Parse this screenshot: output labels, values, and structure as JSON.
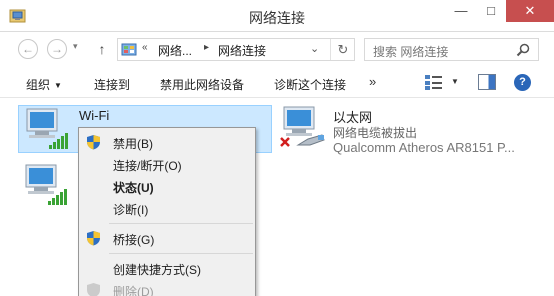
{
  "window": {
    "title": "网络连接",
    "minimize_glyph": "—",
    "maximize_glyph": "□",
    "close_glyph": "✕"
  },
  "address_bar": {
    "back_glyph": "←",
    "forward_glyph": "→",
    "up_glyph": "↑",
    "overflow": "«",
    "crumb_1": "网络...",
    "crumb_sep": "▸",
    "crumb_2": "网络连接",
    "dropdown_glyph": "⌄",
    "refresh_glyph": "↻",
    "search_placeholder": "搜索 网络连接"
  },
  "command_bar": {
    "organize": "组织",
    "connect_to": "连接到",
    "disable_device": "禁用此网络设备",
    "diagnose": "诊断这个连接",
    "more": "»",
    "help": "?"
  },
  "adapters": [
    {
      "name": "Wi-Fi",
      "status": "",
      "icon": "wireless-network-icon"
    },
    {
      "name": "以太网",
      "status": "网络电缆被拔出",
      "device": "Qualcomm Atheros AR8151 P...",
      "icon": "ethernet-disconnected-icon"
    },
    {
      "name": "",
      "status": "",
      "icon": "wireless-network-icon"
    }
  ],
  "context_menu": {
    "items": [
      {
        "label": "禁用(B)",
        "shield": true,
        "bold": false,
        "disabled": false
      },
      {
        "label": "连接/断开(O)",
        "shield": false,
        "bold": false,
        "disabled": false
      },
      {
        "label": "状态(U)",
        "shield": false,
        "bold": true,
        "disabled": false
      },
      {
        "label": "诊断(I)",
        "shield": false,
        "bold": false,
        "disabled": false
      },
      {
        "label": "桥接(G)",
        "shield": true,
        "bold": false,
        "disabled": false
      },
      {
        "label": "创建快捷方式(S)",
        "shield": false,
        "bold": false,
        "disabled": false
      },
      {
        "label": "删除(D)",
        "shield": true,
        "bold": false,
        "disabled": true
      }
    ]
  },
  "colors": {
    "selection_bg": "#cce8ff",
    "selection_border": "#99d1ff",
    "close_button": "#c74f4f",
    "signal_green": "#3aa335",
    "menu_bg": "#f0f0f0"
  }
}
